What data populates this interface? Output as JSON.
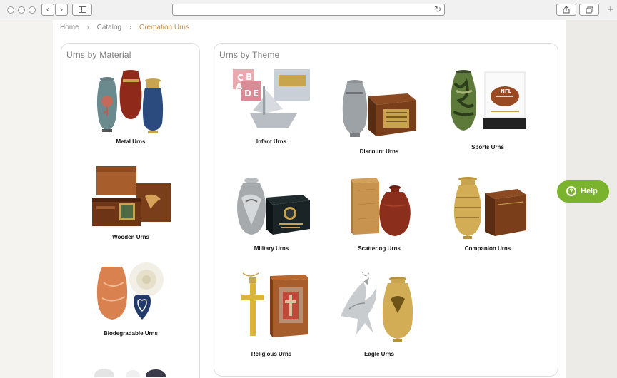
{
  "breadcrumb": {
    "items": [
      "Home",
      "Catalog"
    ],
    "separator": "›",
    "current": "Cremation Urns"
  },
  "material": {
    "title": "Urns by Material",
    "items": [
      "Metal Urns",
      "Wooden Urns",
      "Biodegradable Urns"
    ]
  },
  "theme": {
    "title": "Urns by Theme",
    "items": [
      "Infant Urns",
      "Discount Urns",
      "Sports Urns",
      "Military Urns",
      "Scattering Urns",
      "Companion Urns",
      "Religious Urns",
      "Eagle Urns"
    ]
  },
  "thumb_text": {
    "blocks": [
      "C",
      "B",
      "A",
      "D",
      "E"
    ],
    "football": "NFL"
  },
  "help": {
    "label": "Help",
    "icon": "?"
  },
  "chrome": {
    "reload_icon": "↻",
    "new_tab_icon": "+"
  },
  "colors": {
    "accent": "#c0904a",
    "help_bg": "#7bb22e"
  }
}
